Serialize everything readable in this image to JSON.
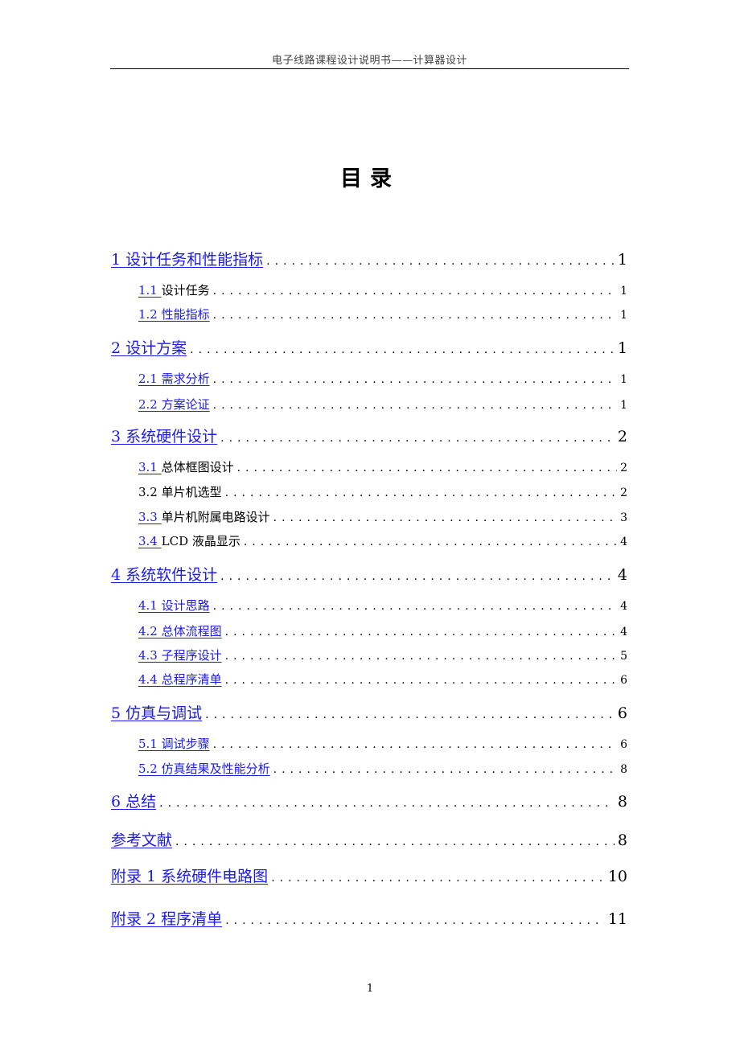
{
  "header": {
    "text": "电子线路课程设计说明书——计算器设计"
  },
  "title": "目录",
  "toc": [
    {
      "number": "1",
      "title": "设计任务和性能指标",
      "page": "1",
      "level": 1
    },
    {
      "number": "1.1",
      "title": "设计任务",
      "page": "1",
      "level": 2,
      "style": "num-link-only"
    },
    {
      "number": "1.2",
      "title": "性能指标",
      "page": "1",
      "level": 2
    },
    {
      "number": "2",
      "title": "设计方案",
      "page": "1",
      "level": 1
    },
    {
      "number": "2.1",
      "title": "需求分析",
      "page": "1",
      "level": 2
    },
    {
      "number": "2.2",
      "title": "方案论证",
      "page": "1",
      "level": 2
    },
    {
      "number": "3",
      "title": "系统硬件设计",
      "page": "2",
      "level": 1
    },
    {
      "number": "3.1",
      "title": "总体框图设计",
      "page": "2",
      "level": 2,
      "style": "num-link-only"
    },
    {
      "number": "3.2",
      "title": "单片机选型",
      "page": "2",
      "level": 2,
      "style": "plain"
    },
    {
      "number": "3.3",
      "title": "单片机附属电路设计",
      "page": "3",
      "level": 2,
      "style": "num-link-only"
    },
    {
      "number": "3.4",
      "title": "LCD 液晶显示",
      "page": "4",
      "level": 2,
      "style": "num-link-only"
    },
    {
      "number": "4",
      "title": "系统软件设计",
      "page": "4",
      "level": 1
    },
    {
      "number": "4.1",
      "title": "设计思路",
      "page": "4",
      "level": 2
    },
    {
      "number": "4.2",
      "title": "总体流程图",
      "page": "4",
      "level": 2
    },
    {
      "number": "4.3",
      "title": "子程序设计",
      "page": "5",
      "level": 2
    },
    {
      "number": "4.4",
      "title": "总程序清单",
      "page": "6",
      "level": 2
    },
    {
      "number": "5",
      "title": "仿真与调试",
      "page": "6",
      "level": 1
    },
    {
      "number": "5.1",
      "title": "调试步骤",
      "page": "6",
      "level": 2
    },
    {
      "number": "5.2",
      "title": "仿真结果及性能分析",
      "page": "8",
      "level": 2
    },
    {
      "number": "6",
      "title": "总结",
      "page": "8",
      "level": 1
    },
    {
      "number": "",
      "title": "参考文献",
      "page": "8",
      "level": 1
    },
    {
      "number": "附录 1",
      "title": "系统硬件电路图",
      "page": "10",
      "level": 1
    },
    {
      "number": "附录 2",
      "title": "程序清单",
      "page": "11",
      "level": 1
    }
  ],
  "footer": {
    "page_number": "1"
  },
  "colors": {
    "link": "#1a1aee",
    "text": "#000000"
  }
}
